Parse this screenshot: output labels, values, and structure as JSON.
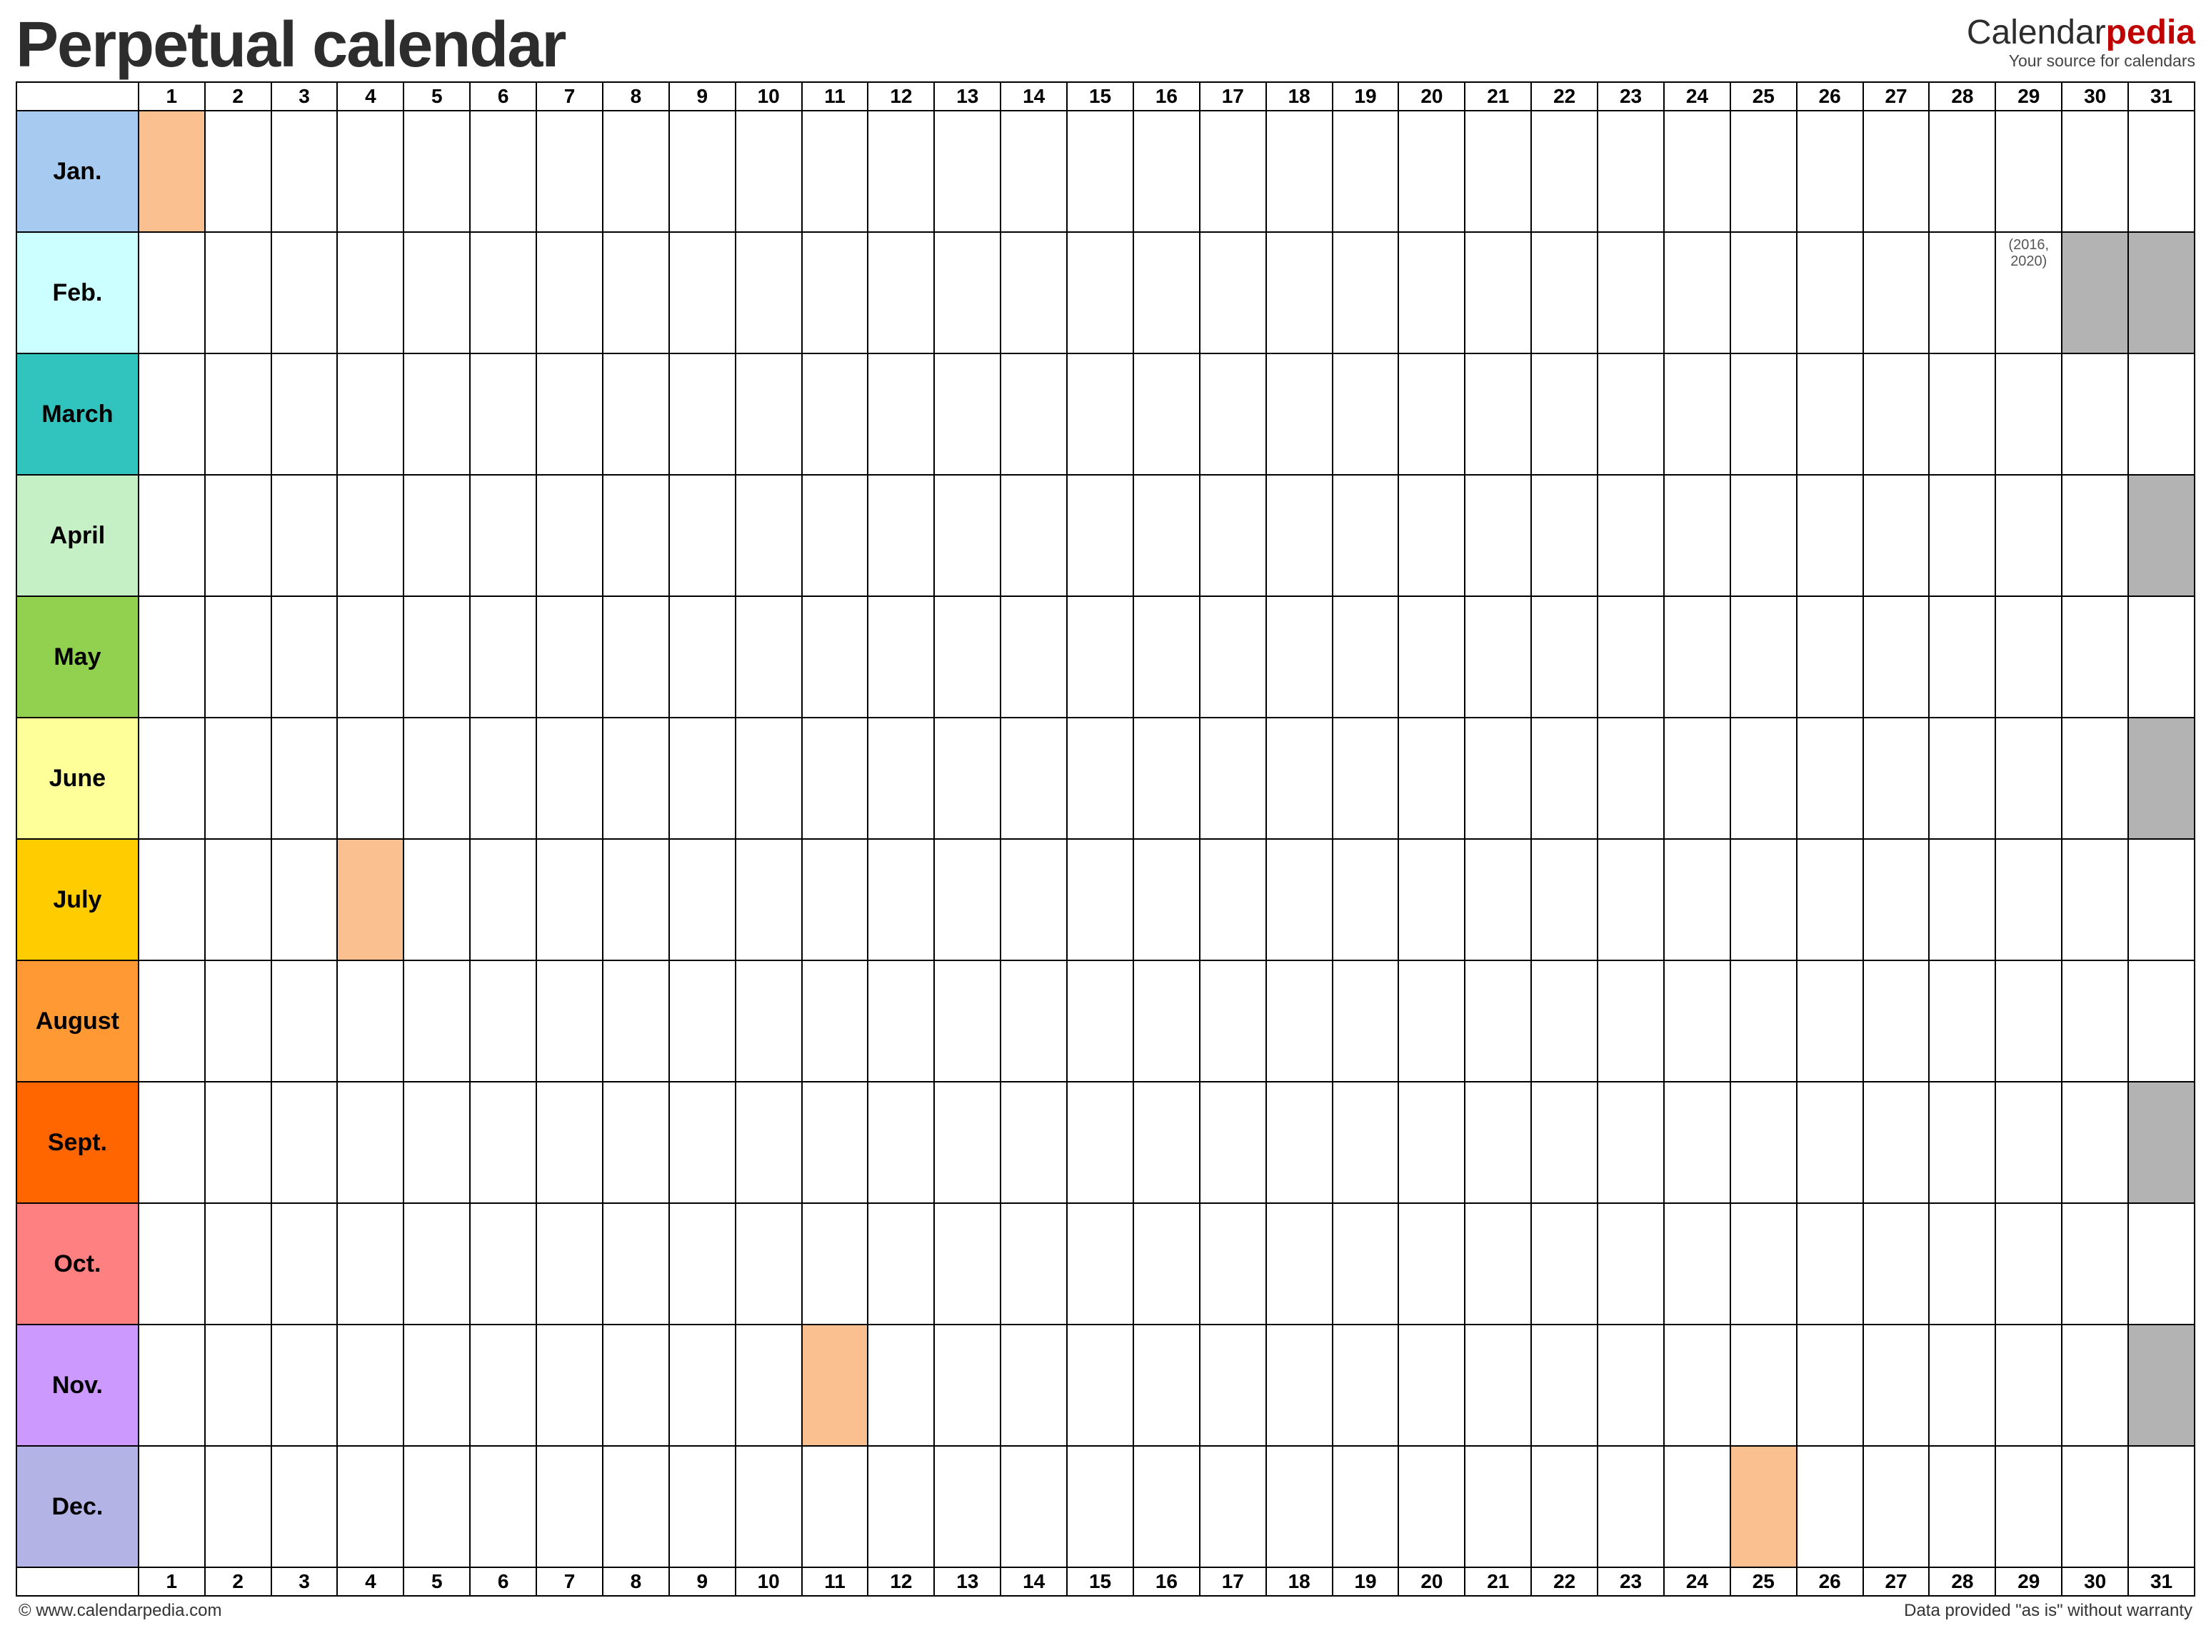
{
  "title": "Perpetual calendar",
  "brand": {
    "part1": "Calendar",
    "part2": "pedia",
    "tagline": "Your source for calendars"
  },
  "days": [
    "1",
    "2",
    "3",
    "4",
    "5",
    "6",
    "7",
    "8",
    "9",
    "10",
    "11",
    "12",
    "13",
    "14",
    "15",
    "16",
    "17",
    "18",
    "19",
    "20",
    "21",
    "22",
    "23",
    "24",
    "25",
    "26",
    "27",
    "28",
    "29",
    "30",
    "31"
  ],
  "months": [
    {
      "name": "Jan.",
      "color": "#a6caf0",
      "cells": [
        {
          "d": 1,
          "hl": true
        }
      ]
    },
    {
      "name": "Feb.",
      "color": "#ccffff",
      "cells": [
        {
          "d": 29,
          "note": "(2016, 2020)"
        },
        {
          "d": 30,
          "dis": true
        },
        {
          "d": 31,
          "dis": true
        }
      ]
    },
    {
      "name": "March",
      "color": "#31c3be",
      "cells": []
    },
    {
      "name": "April",
      "color": "#c5f0c5",
      "cells": [
        {
          "d": 31,
          "dis": true
        }
      ]
    },
    {
      "name": "May",
      "color": "#92d050",
      "cells": []
    },
    {
      "name": "June",
      "color": "#ffff99",
      "cells": [
        {
          "d": 31,
          "dis": true
        }
      ]
    },
    {
      "name": "July",
      "color": "#ffcc00",
      "cells": [
        {
          "d": 4,
          "hl": true
        }
      ]
    },
    {
      "name": "August",
      "color": "#ff9933",
      "cells": []
    },
    {
      "name": "Sept.",
      "color": "#ff6600",
      "cells": [
        {
          "d": 31,
          "dis": true
        }
      ]
    },
    {
      "name": "Oct.",
      "color": "#ff8080",
      "cells": []
    },
    {
      "name": "Nov.",
      "color": "#cc99ff",
      "cells": [
        {
          "d": 11,
          "hl": true
        },
        {
          "d": 31,
          "dis": true
        }
      ]
    },
    {
      "name": "Dec.",
      "color": "#b3b3e6",
      "cells": [
        {
          "d": 25,
          "hl": true
        }
      ]
    }
  ],
  "footer": {
    "left": "© www.calendarpedia.com",
    "right": "Data provided \"as is\" without warranty"
  }
}
